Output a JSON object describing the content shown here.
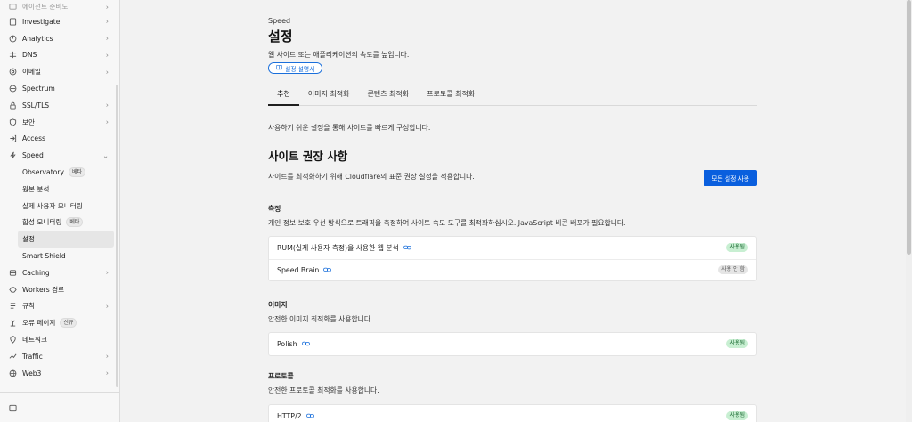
{
  "sidebar": {
    "items": [
      {
        "label": "에이전트 준비도",
        "icon": "agent-icon",
        "chevron": true,
        "faded": true
      },
      {
        "label": "Investigate",
        "icon": "investigate-icon",
        "chevron": true
      },
      {
        "label": "Analytics",
        "icon": "analytics-icon",
        "chevron": true
      },
      {
        "label": "DNS",
        "icon": "dns-icon",
        "chevron": true
      },
      {
        "label": "이메일",
        "icon": "email-icon",
        "chevron": true
      },
      {
        "label": "Spectrum",
        "icon": "spectrum-icon",
        "chevron": false
      },
      {
        "label": "SSL/TLS",
        "icon": "lock-icon",
        "chevron": true
      },
      {
        "label": "보안",
        "icon": "shield-icon",
        "chevron": true
      },
      {
        "label": "Access",
        "icon": "access-icon",
        "chevron": false
      },
      {
        "label": "Speed",
        "icon": "lightning-icon",
        "chevron": "down"
      },
      {
        "label": "Observatory",
        "badge": "베타",
        "sub": true
      },
      {
        "label": "원본 분석",
        "sub": true
      },
      {
        "label": "실제 사용자 모니터링",
        "sub": true
      },
      {
        "label": "합성 모니터링",
        "badge": "베타",
        "sub": true
      },
      {
        "label": "설정",
        "sub": true,
        "active": true
      },
      {
        "label": "Smart Shield",
        "sub": true
      },
      {
        "label": "Caching",
        "icon": "caching-icon",
        "chevron": true
      },
      {
        "label": "Workers 경로",
        "icon": "workers-icon",
        "chevron": false
      },
      {
        "label": "규칙",
        "icon": "rules-icon",
        "chevron": true
      },
      {
        "label": "오류 페이지",
        "icon": "error-page-icon",
        "badge": "신규",
        "chevron": false
      },
      {
        "label": "네트워크",
        "icon": "network-icon",
        "chevron": false
      },
      {
        "label": "Traffic",
        "icon": "traffic-icon",
        "chevron": true
      },
      {
        "label": "Web3",
        "icon": "web3-icon",
        "chevron": true
      }
    ]
  },
  "header": {
    "eyebrow": "Speed",
    "title": "설정",
    "description": "웹 사이트 또는 애플리케이션의 속도를 높입니다.",
    "doc_button": "설정 설명서"
  },
  "tabs": [
    {
      "label": "추천",
      "active": true
    },
    {
      "label": "이미지 최적화",
      "active": false
    },
    {
      "label": "콘텐츠 최적화",
      "active": false
    },
    {
      "label": "프로토콜 최적화",
      "active": false
    }
  ],
  "intro": "사용하기 쉬운 설정을 통해 사이트를 빠르게 구성합니다.",
  "recommendations": {
    "title": "사이트 권장 사항",
    "description": "사이트를 최적화하기 위해 Cloudflare의 표준 권장 설정을 적용합니다.",
    "apply_button": "모든 설정 사용"
  },
  "groups": [
    {
      "title": "측정",
      "description": "개인 정보 보호 우선 방식으로 트래픽을 측정하여 사이트 속도 도구를 최적화하십시오. JavaScript 비콘 배포가 필요합니다.",
      "rows": [
        {
          "label": "RUM(실제 사용자 측정)을 사용한 웹 분석",
          "status": "사용됨",
          "enabled": true
        },
        {
          "label": "Speed Brain",
          "status": "사용 안 함",
          "enabled": false
        }
      ]
    },
    {
      "title": "이미지",
      "description": "안전한 이미지 최적화를 사용합니다.",
      "rows": [
        {
          "label": "Polish",
          "status": "사용됨",
          "enabled": true
        }
      ]
    },
    {
      "title": "프로토콜",
      "description": "안전한 프로토콜 최적화를 사용합니다.",
      "rows": [
        {
          "label": "HTTP/2",
          "status": "사용됨",
          "enabled": true
        }
      ]
    }
  ],
  "colors": {
    "accent": "#0a5fde",
    "enabled_bg": "#c8efd2",
    "disabled_bg": "#e5e5e5"
  }
}
